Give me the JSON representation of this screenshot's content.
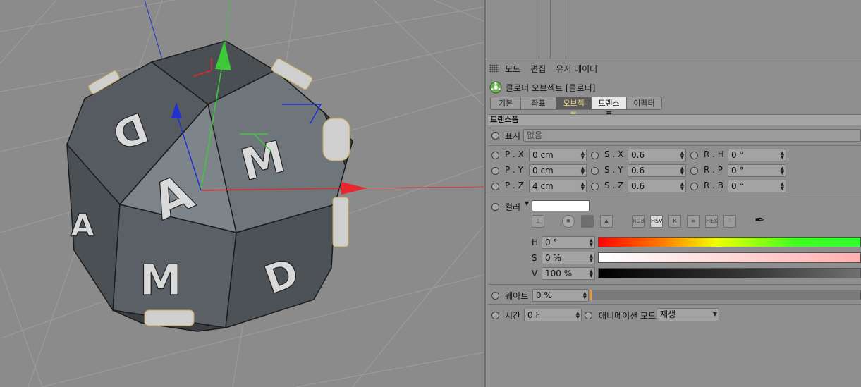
{
  "menu": {
    "items": [
      "모드",
      "편집",
      "유저 데이터"
    ]
  },
  "object": {
    "title": "클로너 오브젝트 [클로너]"
  },
  "tabs": [
    {
      "label": "기본",
      "state": "normal"
    },
    {
      "label": "좌표",
      "state": "normal"
    },
    {
      "label": "오브젝트",
      "state": "active-yellow"
    },
    {
      "label": "트랜스폼",
      "state": "active"
    },
    {
      "label": "이펙터",
      "state": "normal"
    }
  ],
  "section": {
    "title": "트랜스폼"
  },
  "display": {
    "label": "표시",
    "value": "없음"
  },
  "position": {
    "px": {
      "label": "P . X",
      "value": "0 cm"
    },
    "py": {
      "label": "P . Y",
      "value": "0 cm"
    },
    "pz": {
      "label": "P . Z",
      "value": "4 cm"
    }
  },
  "scale": {
    "sx": {
      "label": "S . X",
      "value": "0.6"
    },
    "sy": {
      "label": "S . Y",
      "value": "0.6"
    },
    "sz": {
      "label": "S . Z",
      "value": "0.6"
    }
  },
  "rotation": {
    "rh": {
      "label": "R . H",
      "value": "0 °"
    },
    "rp": {
      "label": "R . P",
      "value": "0 °"
    },
    "rb": {
      "label": "R . B",
      "value": "0 °"
    }
  },
  "color": {
    "label": "컬러",
    "swatch": "#ffffff",
    "tools": [
      "RGB",
      "HSV",
      "K",
      "HEX"
    ],
    "h": {
      "label": "H",
      "value": "0 °"
    },
    "s": {
      "label": "S",
      "value": "0 %"
    },
    "v": {
      "label": "V",
      "value": "100 %"
    }
  },
  "weight": {
    "label": "웨이트",
    "value": "0 %"
  },
  "time": {
    "label": "시간",
    "value": "0 F"
  },
  "animation_mode": {
    "label": "애니메이션 모드",
    "value": "재생"
  },
  "viewport": {
    "face_letters": [
      "D",
      "A",
      "M",
      "M",
      "A",
      "D"
    ],
    "axis_colors": {
      "x": "#e8262c",
      "y": "#3ec93a",
      "z": "#2230d0"
    }
  }
}
